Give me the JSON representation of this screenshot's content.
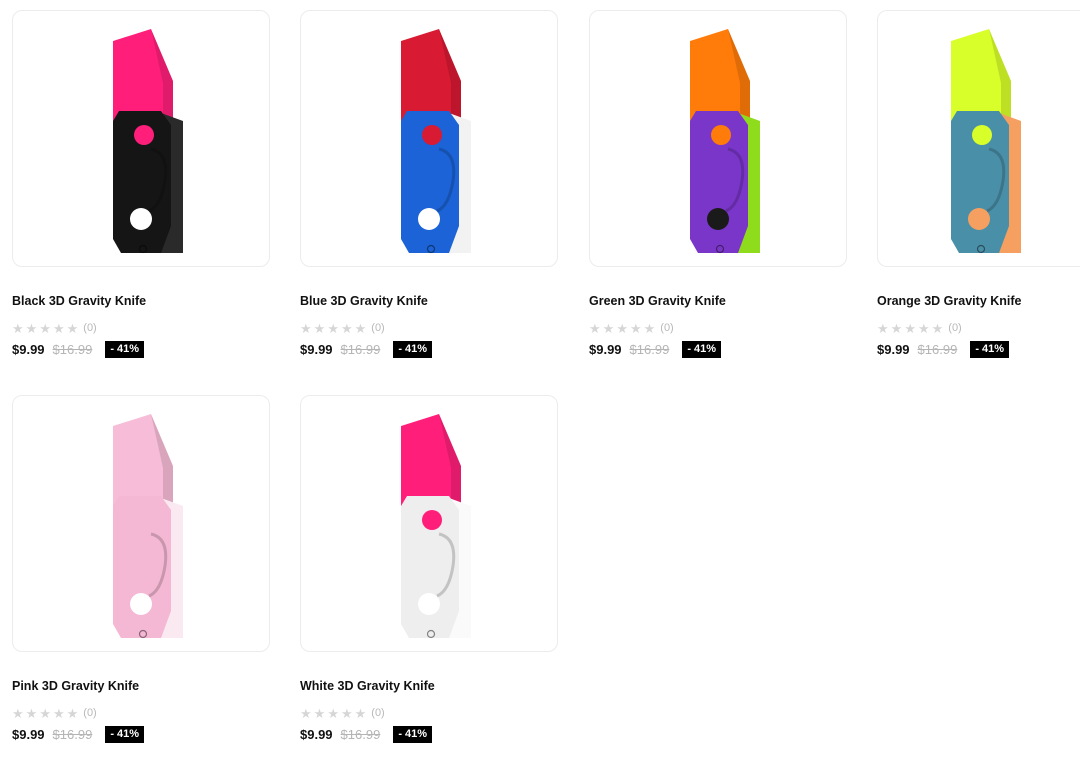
{
  "products": [
    {
      "name": "Black 3D Gravity Knife",
      "rating_count": "(0)",
      "price": "$9.99",
      "old_price": "$16.99",
      "discount": "- 41%",
      "colors": {
        "blade": "#ff1f7a",
        "body": "#151515",
        "side": "#2a2a2a",
        "accent": "#ff1f7a",
        "hole": "#ffffff"
      }
    },
    {
      "name": "Blue 3D Gravity Knife",
      "rating_count": "(0)",
      "price": "$9.99",
      "old_price": "$16.99",
      "discount": "- 41%",
      "colors": {
        "blade": "#d81a33",
        "body": "#1b63d6",
        "side": "#f2f2f2",
        "accent": "#d81a33",
        "hole": "#ffffff"
      }
    },
    {
      "name": "Green 3D Gravity Knife",
      "rating_count": "(0)",
      "price": "$9.99",
      "old_price": "$16.99",
      "discount": "- 41%",
      "colors": {
        "blade": "#ff7b0a",
        "body": "#7a36c8",
        "side": "#8fdc1c",
        "accent": "#ff7b0a",
        "hole": "#1a1a1a"
      }
    },
    {
      "name": "Orange 3D Gravity Knife",
      "rating_count": "(0)",
      "price": "$9.99",
      "old_price": "$16.99",
      "discount": "- 41%",
      "colors": {
        "blade": "#d8ff2a",
        "body": "#4a8fa8",
        "side": "#f5a060",
        "accent": "#d8ff2a",
        "hole": "#f5a060"
      }
    },
    {
      "name": "Pink 3D Gravity Knife",
      "rating_count": "(0)",
      "price": "$9.99",
      "old_price": "$16.99",
      "discount": "- 41%",
      "colors": {
        "blade": "#f6bcd8",
        "body": "#f4b8d4",
        "side": "#fbe9f2",
        "accent": "#f4b8d4",
        "hole": "#ffffff"
      }
    },
    {
      "name": "White 3D Gravity Knife",
      "rating_count": "(0)",
      "price": "$9.99",
      "old_price": "$16.99",
      "discount": "- 41%",
      "colors": {
        "blade": "#ff1f7a",
        "body": "#eeeeee",
        "side": "#fafafa",
        "accent": "#ff1f7a",
        "hole": "#ffffff"
      }
    }
  ]
}
